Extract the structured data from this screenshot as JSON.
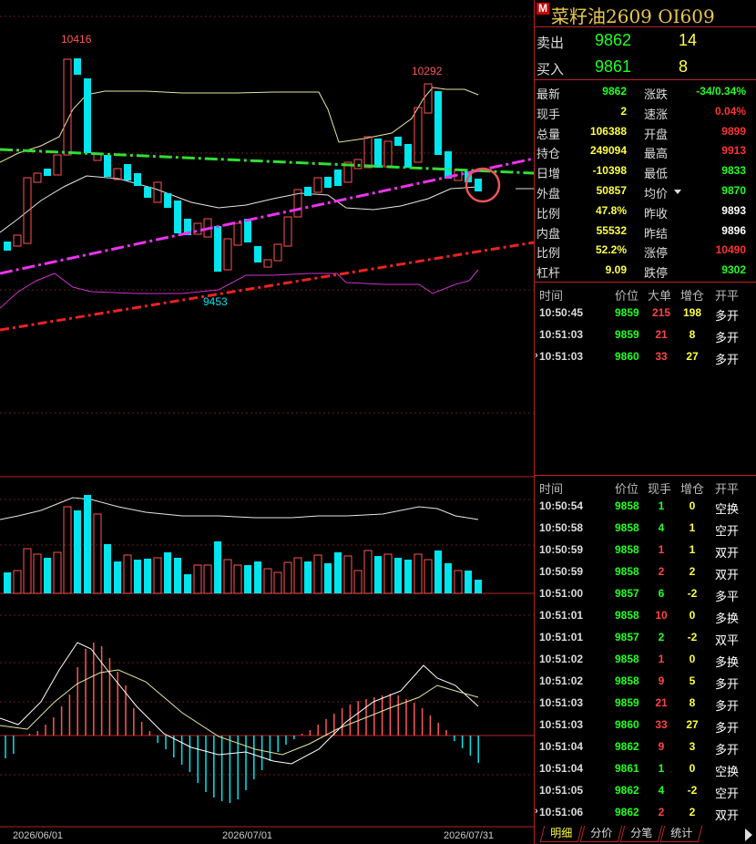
{
  "header": {
    "badge": "M",
    "title": "菜籽油2609  OI609"
  },
  "orderbook": [
    {
      "label": "卖出",
      "price": "9862",
      "volume": "14"
    },
    {
      "label": "买入",
      "price": "9861",
      "volume": "8"
    }
  ],
  "quote": [
    {
      "k1": "最新",
      "v1": "9862",
      "c1": "#2f2",
      "k2": "涨跌",
      "v2": "-34/0.34%",
      "c2": "#2f2"
    },
    {
      "k1": "现手",
      "v1": "2",
      "c1": "#ff4",
      "k2": "速涨",
      "v2": "0.04%",
      "c2": "#f33"
    },
    {
      "k1": "总量",
      "v1": "106388",
      "c1": "#ff4",
      "k2": "开盘",
      "v2": "9899",
      "c2": "#f33"
    },
    {
      "k1": "持仓",
      "v1": "249094",
      "c1": "#ff4",
      "k2": "最高",
      "v2": "9913",
      "c2": "#f33"
    },
    {
      "k1": "日增",
      "v1": "-10398",
      "c1": "#ff4",
      "k2": "最低",
      "v2": "9833",
      "c2": "#2f2"
    },
    {
      "k1": "外盘",
      "v1": "50857",
      "c1": "#ff4",
      "k2": "均价",
      "v2": "9870",
      "c2": "#2f2"
    },
    {
      "k1": "比例",
      "v1": "47.8%",
      "c1": "#ff4",
      "k2": "昨收",
      "v2": "9893",
      "c2": "#fff"
    },
    {
      "k1": "内盘",
      "v1": "55532",
      "c1": "#ff4",
      "k2": "昨结",
      "v2": "9896",
      "c2": "#fff"
    },
    {
      "k1": "比例",
      "v1": "52.2%",
      "c1": "#ff4",
      "k2": "涨停",
      "v2": "10490",
      "c2": "#f33"
    },
    {
      "k1": "杠杆",
      "v1": "9.09",
      "c1": "#ff4",
      "k2": "跌停",
      "v2": "9302",
      "c2": "#2f2"
    }
  ],
  "ticks1": {
    "headers": {
      "time": "时间",
      "price": "价位",
      "big": "大单",
      "pos": "增仓",
      "type": "开平"
    },
    "rows": [
      {
        "time": "10:50:45",
        "price": "9859",
        "big": "215",
        "pos": "198",
        "type": "多开",
        "mark": ""
      },
      {
        "time": "10:51:03",
        "price": "9859",
        "big": "21",
        "pos": "8",
        "type": "多开",
        "mark": ""
      },
      {
        "time": "10:51:03",
        "price": "9860",
        "big": "33",
        "pos": "27",
        "type": "多开",
        "mark": "›"
      }
    ]
  },
  "ticks2": {
    "headers": {
      "time": "时间",
      "price": "价位",
      "big": "现手",
      "pos": "增仓",
      "type": "开平"
    },
    "rows": [
      {
        "time": "10:50:54",
        "price": "9858",
        "big": "1",
        "pos": "0",
        "type": "空换",
        "mark": ""
      },
      {
        "time": "10:50:58",
        "price": "9858",
        "big": "4",
        "pos": "1",
        "type": "空开",
        "mark": ""
      },
      {
        "time": "10:50:59",
        "price": "9858",
        "big": "1",
        "pos": "1",
        "type": "双开",
        "mark": ""
      },
      {
        "time": "10:50:59",
        "price": "9858",
        "big": "2",
        "pos": "2",
        "type": "双开",
        "mark": ""
      },
      {
        "time": "10:51:00",
        "price": "9857",
        "big": "6",
        "pos": "-2",
        "type": "多平",
        "mark": ""
      },
      {
        "time": "10:51:01",
        "price": "9858",
        "big": "10",
        "pos": "0",
        "type": "多换",
        "mark": ""
      },
      {
        "time": "10:51:01",
        "price": "9857",
        "big": "2",
        "pos": "-2",
        "type": "双平",
        "mark": ""
      },
      {
        "time": "10:51:02",
        "price": "9858",
        "big": "1",
        "pos": "0",
        "type": "多换",
        "mark": ""
      },
      {
        "time": "10:51:02",
        "price": "9858",
        "big": "9",
        "pos": "5",
        "type": "多开",
        "mark": ""
      },
      {
        "time": "10:51:03",
        "price": "9859",
        "big": "21",
        "pos": "8",
        "type": "多开",
        "mark": ""
      },
      {
        "time": "10:51:03",
        "price": "9860",
        "big": "33",
        "pos": "27",
        "type": "多开",
        "mark": ""
      },
      {
        "time": "10:51:04",
        "price": "9862",
        "big": "9",
        "pos": "3",
        "type": "多开",
        "mark": ""
      },
      {
        "time": "10:51:04",
        "price": "9861",
        "big": "1",
        "pos": "0",
        "type": "空换",
        "mark": ""
      },
      {
        "time": "10:51:05",
        "price": "9862",
        "big": "4",
        "pos": "-2",
        "type": "空开",
        "mark": ""
      },
      {
        "time": "10:51:06",
        "price": "9862",
        "big": "2",
        "pos": "2",
        "type": "双开",
        "mark": "›"
      }
    ]
  },
  "tabs": [
    "明细",
    "分价",
    "分笔",
    "统计"
  ],
  "chart_labels": {
    "high": "10416",
    "high2": "10292",
    "low": "9453"
  },
  "dates": [
    "2026/06/01",
    "2026/07/01",
    "2026/07/31"
  ],
  "colors": {
    "up": "#ff5555",
    "down": "#00e5ee",
    "border": "#b22222",
    "trend_green": "#33dd33",
    "trend_magenta": "#ee33ee",
    "trend_red": "#ee2222"
  }
}
